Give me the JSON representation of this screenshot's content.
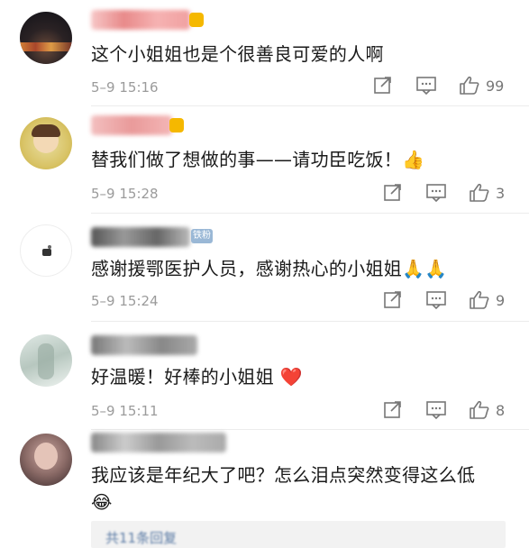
{
  "comments": [
    {
      "text": "这个小姐姐也是个很善良可爱的人啊",
      "time": "5–9 15:16",
      "likes": "99",
      "emoji": ""
    },
    {
      "text": "替我们做了想做的事——请功臣吃饭！",
      "time": "5–9 15:28",
      "likes": "3",
      "emoji": "👍"
    },
    {
      "text": "感谢援鄂医护人员，感谢热心的小姐姐",
      "time": "5–9 15:24",
      "likes": "9",
      "emoji": "🙏🙏"
    },
    {
      "text": "好温暖！好棒的小姐姐",
      "time": "5–9 15:11",
      "likes": "8",
      "emoji": "❤️"
    },
    {
      "text": "我应该是年纪大了吧？怎么泪点突然变得这么低",
      "time": "",
      "likes": "",
      "emoji": "😂"
    }
  ],
  "badges": {
    "fan_badge": "铁粉"
  },
  "replies_link": "共11条回复",
  "icons": [
    "share-icon",
    "comment-icon",
    "like-icon"
  ]
}
